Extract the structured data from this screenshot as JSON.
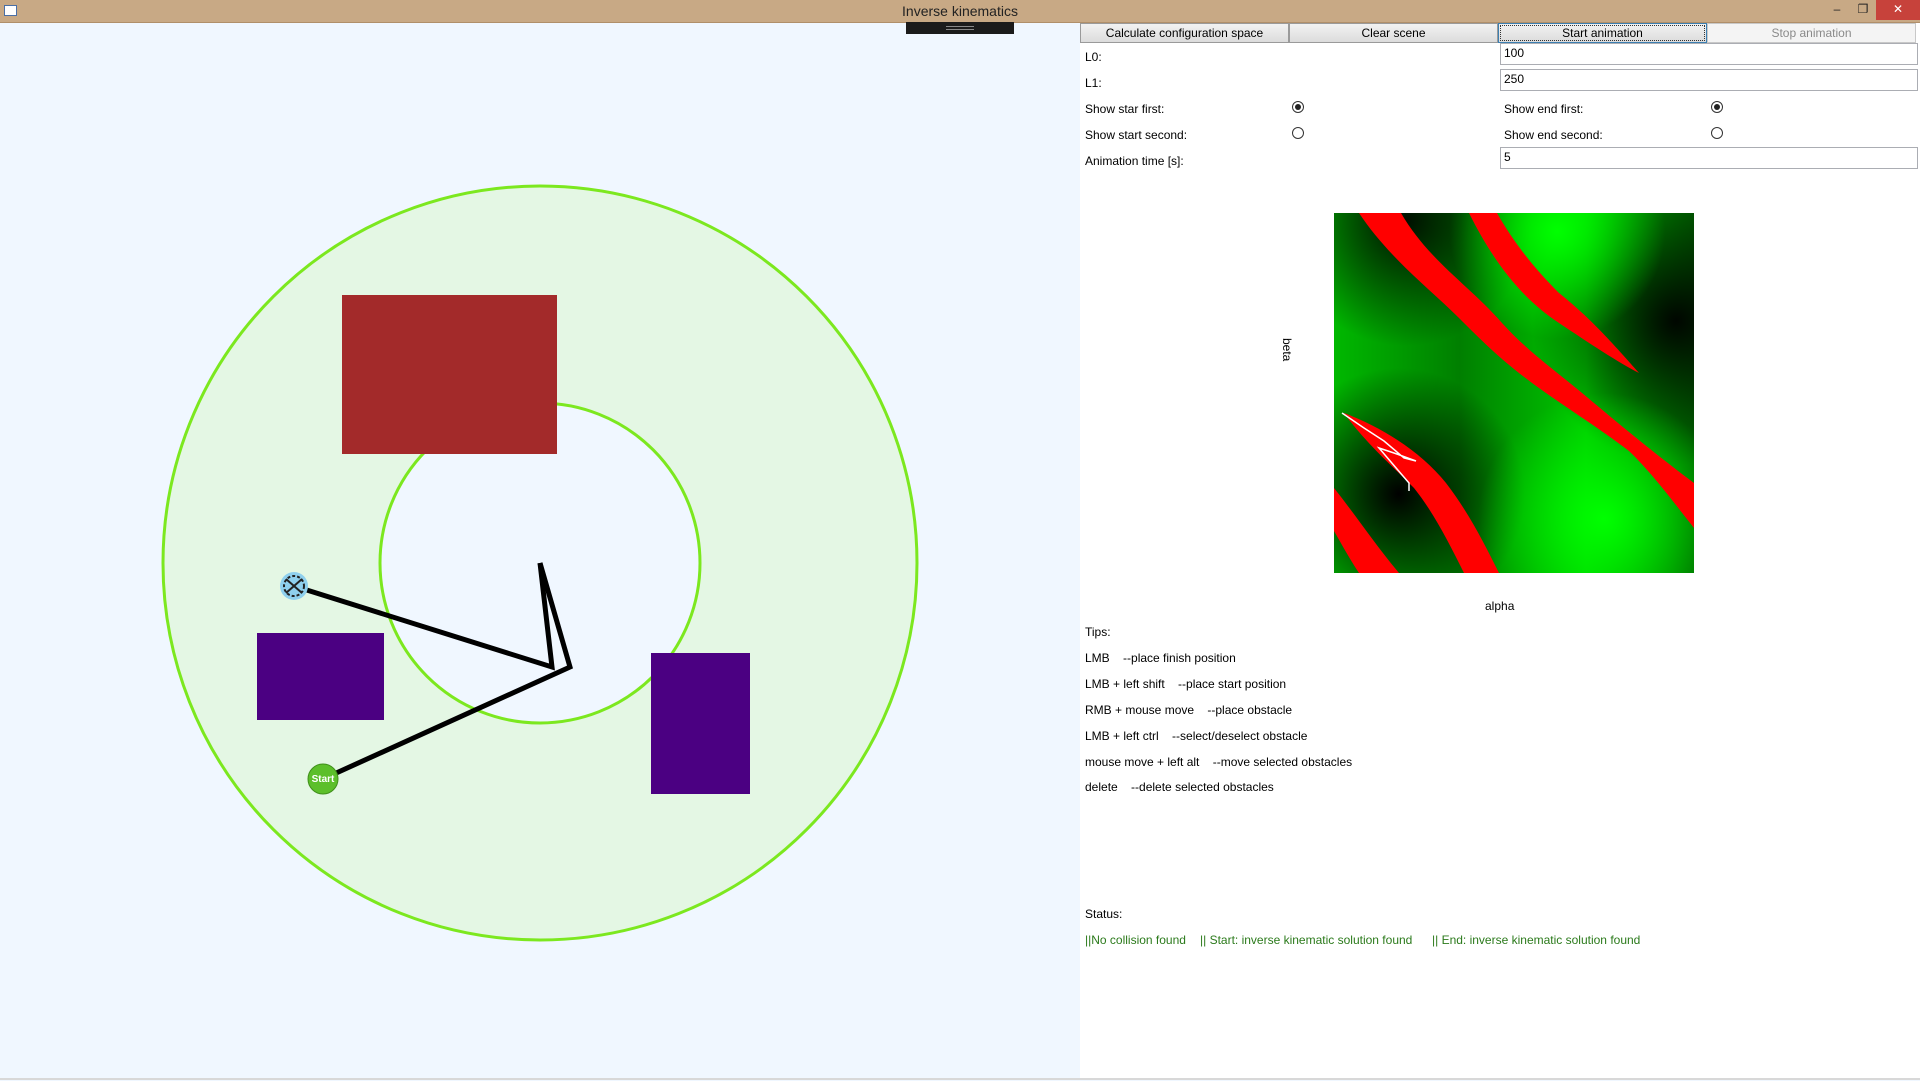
{
  "window": {
    "title": "Inverse kinematics",
    "minimize_icon": "minimize-icon",
    "maximize_icon": "restore-icon",
    "close_icon": "close-icon"
  },
  "toolbar": {
    "calc_label": "Calculate configuration space",
    "clear_label": "Clear scene",
    "start_label": "Start animation",
    "stop_label": "Stop animation"
  },
  "form": {
    "l0_label": "L0:",
    "l0_value": "100",
    "l1_label": "L1:",
    "l1_value": "250",
    "show_star_first_label": "Show star first:",
    "show_start_second_label": "Show start second:",
    "show_end_first_label": "Show end first:",
    "show_end_second_label": "Show end second:",
    "animation_time_label": "Animation time [s]:",
    "animation_time_value": "5"
  },
  "config_space": {
    "x_label": "alpha",
    "y_label": "beta"
  },
  "tips": {
    "heading": "Tips:",
    "items": [
      {
        "key": "LMB",
        "desc": "--place finish position"
      },
      {
        "key": "LMB + left shift",
        "desc": "--place start position"
      },
      {
        "key": "RMB + mouse move",
        "desc": "--place obstacle"
      },
      {
        "key": "LMB + left ctrl",
        "desc": "--select/deselect obstacle"
      },
      {
        "key": "mouse move + left alt",
        "desc": "--move selected obstacles"
      },
      {
        "key": "delete",
        "desc": "--delete selected obstacles"
      }
    ]
  },
  "status": {
    "heading": "Status:",
    "collision": "||No collision found",
    "start": "|| Start:   inverse kinematic solution found",
    "end": "|| End:   inverse kinematic solution found"
  },
  "scene": {
    "start_label": "Start",
    "colors": {
      "ring_stroke": "#7ce81f",
      "ring_fill": "#e4f7e4",
      "obstacle_red": "#a32a2a",
      "obstacle_purple": "#4b0082",
      "arm": "#000000",
      "start_marker": "#5cbf2a",
      "end_marker": "#8fd0ee"
    }
  }
}
